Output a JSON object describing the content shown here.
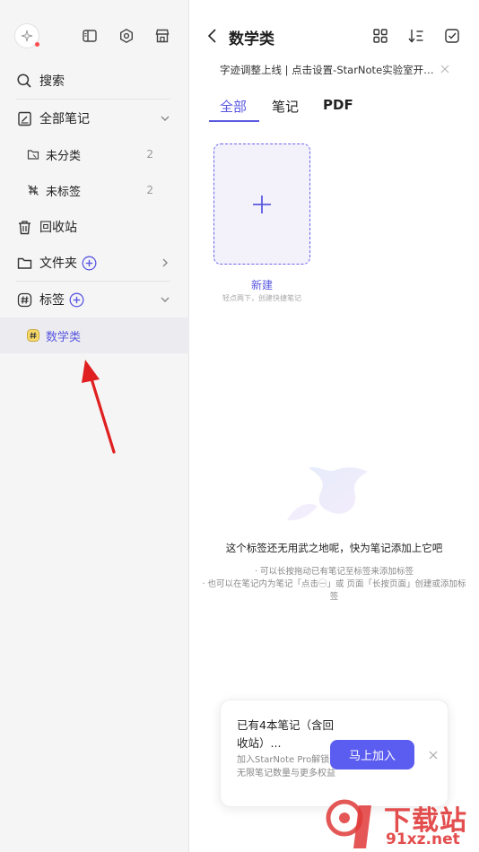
{
  "sidebar": {
    "items": [
      {
        "label": "搜索"
      },
      {
        "label": "全部笔记"
      },
      {
        "label": "未分类",
        "count": "2"
      },
      {
        "label": "未标签",
        "count": "2"
      },
      {
        "label": "回收站"
      },
      {
        "label": "文件夹"
      },
      {
        "label": "标签"
      },
      {
        "label": "数学类"
      }
    ]
  },
  "header": {
    "title": "数学类",
    "notice": "字迹调整上线 | 点击设置-StarNote实验室开…"
  },
  "tabs": [
    {
      "label": "全部"
    },
    {
      "label": "笔记"
    },
    {
      "label": "PDF"
    }
  ],
  "new_card": {
    "label": "新建",
    "hint": "轻点两下，创建快捷笔记"
  },
  "empty_state": {
    "title": "这个标签还无用武之地呢，快为笔记添加上它吧",
    "line1": "· 可以长按拖动已有笔记至标签来添加标签",
    "line2": "· 也可以在笔记内为笔记「点击㊀」或 页面「长按页面」创建或添加标",
    "line3": "签"
  },
  "promo": {
    "title": "已有4本笔记（含回收站）...",
    "desc": "加入StarNote Pro解锁无限笔记数量与更多权益",
    "button": "马上加入"
  },
  "watermark": {
    "brand": "下载站",
    "url": "91xz.net"
  },
  "colors": {
    "accent": "#5a58e0",
    "sidebar_bg": "#f5f5f6",
    "annotation": "#e02020"
  }
}
